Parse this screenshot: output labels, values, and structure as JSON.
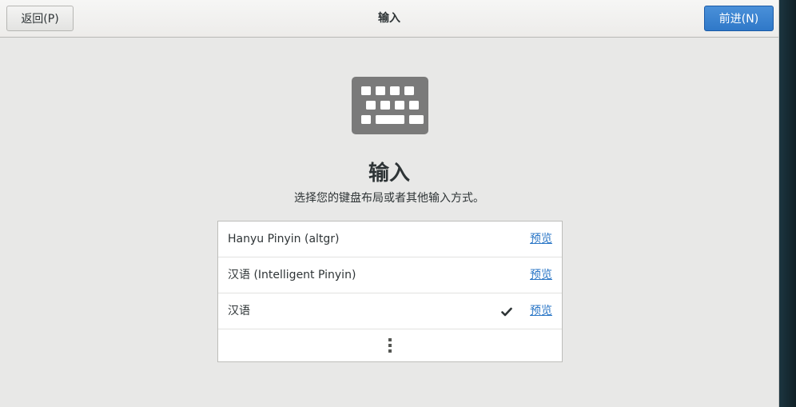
{
  "header": {
    "back_label": "返回(P)",
    "title": "输入",
    "next_label": "前进(N)"
  },
  "main": {
    "icon": "keyboard-icon",
    "title": "输入",
    "subtitle": "选择您的键盘布局或者其他输入方式。"
  },
  "input_sources": [
    {
      "label": "Hanyu Pinyin (altgr)",
      "preview_label": "预览",
      "selected": false
    },
    {
      "label": "汉语 (Intelligent Pinyin)",
      "preview_label": "预览",
      "selected": false
    },
    {
      "label": "汉语",
      "preview_label": "预览",
      "selected": true
    }
  ],
  "more_icon": "vertical-ellipsis-icon",
  "colors": {
    "window_bg": "#e8e8e7",
    "accent": "#4a90d9",
    "link": "#2a76c6",
    "icon_gray": "#7a7a7a"
  }
}
